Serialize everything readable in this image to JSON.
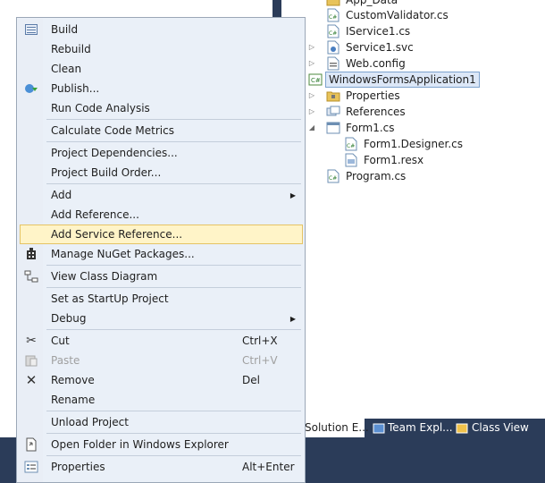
{
  "solution_tree": {
    "items": [
      {
        "label": "App_Data",
        "icon": "folder-icon",
        "arrow": false
      },
      {
        "label": "CustomValidator.cs",
        "icon": "cs-file-icon",
        "arrow": false
      },
      {
        "label": "IService1.cs",
        "icon": "cs-file-icon",
        "arrow": false
      },
      {
        "label": "Service1.svc",
        "icon": "svc-file-icon",
        "arrow": true
      },
      {
        "label": "Web.config",
        "icon": "config-file-icon",
        "arrow": true
      },
      {
        "label": "WindowsFormsApplication1",
        "icon": "cs-project-icon",
        "arrow": false,
        "selected": true
      },
      {
        "label": "Properties",
        "icon": "properties-folder-icon",
        "arrow": true
      },
      {
        "label": "References",
        "icon": "references-icon",
        "arrow": true
      },
      {
        "label": "Form1.cs",
        "icon": "form-file-icon",
        "arrow": "expanded"
      },
      {
        "label": "Form1.Designer.cs",
        "icon": "cs-file-icon",
        "arrow": false
      },
      {
        "label": "Form1.resx",
        "icon": "resx-file-icon",
        "arrow": false
      },
      {
        "label": "Program.cs",
        "icon": "cs-file-icon",
        "arrow": false
      }
    ]
  },
  "tabs": {
    "solution_explorer": "Solution E...",
    "team_explorer": "Team Expl...",
    "class_view": "Class View"
  },
  "menu": {
    "build": "Build",
    "rebuild": "Rebuild",
    "clean": "Clean",
    "publish": "Publish...",
    "run_code_analysis": "Run Code Analysis",
    "calculate_code_metrics": "Calculate Code Metrics",
    "project_dependencies": "Project Dependencies...",
    "project_build_order": "Project Build Order...",
    "add": "Add",
    "add_reference": "Add Reference...",
    "add_service_reference": "Add Service Reference...",
    "manage_nuget": "Manage NuGet Packages...",
    "view_class_diagram": "View Class Diagram",
    "set_startup": "Set as StartUp Project",
    "debug": "Debug",
    "cut": "Cut",
    "cut_shortcut": "Ctrl+X",
    "paste": "Paste",
    "paste_shortcut": "Ctrl+V",
    "remove": "Remove",
    "remove_shortcut": "Del",
    "rename": "Rename",
    "unload_project": "Unload Project",
    "open_folder": "Open Folder in Windows Explorer",
    "properties": "Properties",
    "properties_shortcut": "Alt+Enter"
  }
}
